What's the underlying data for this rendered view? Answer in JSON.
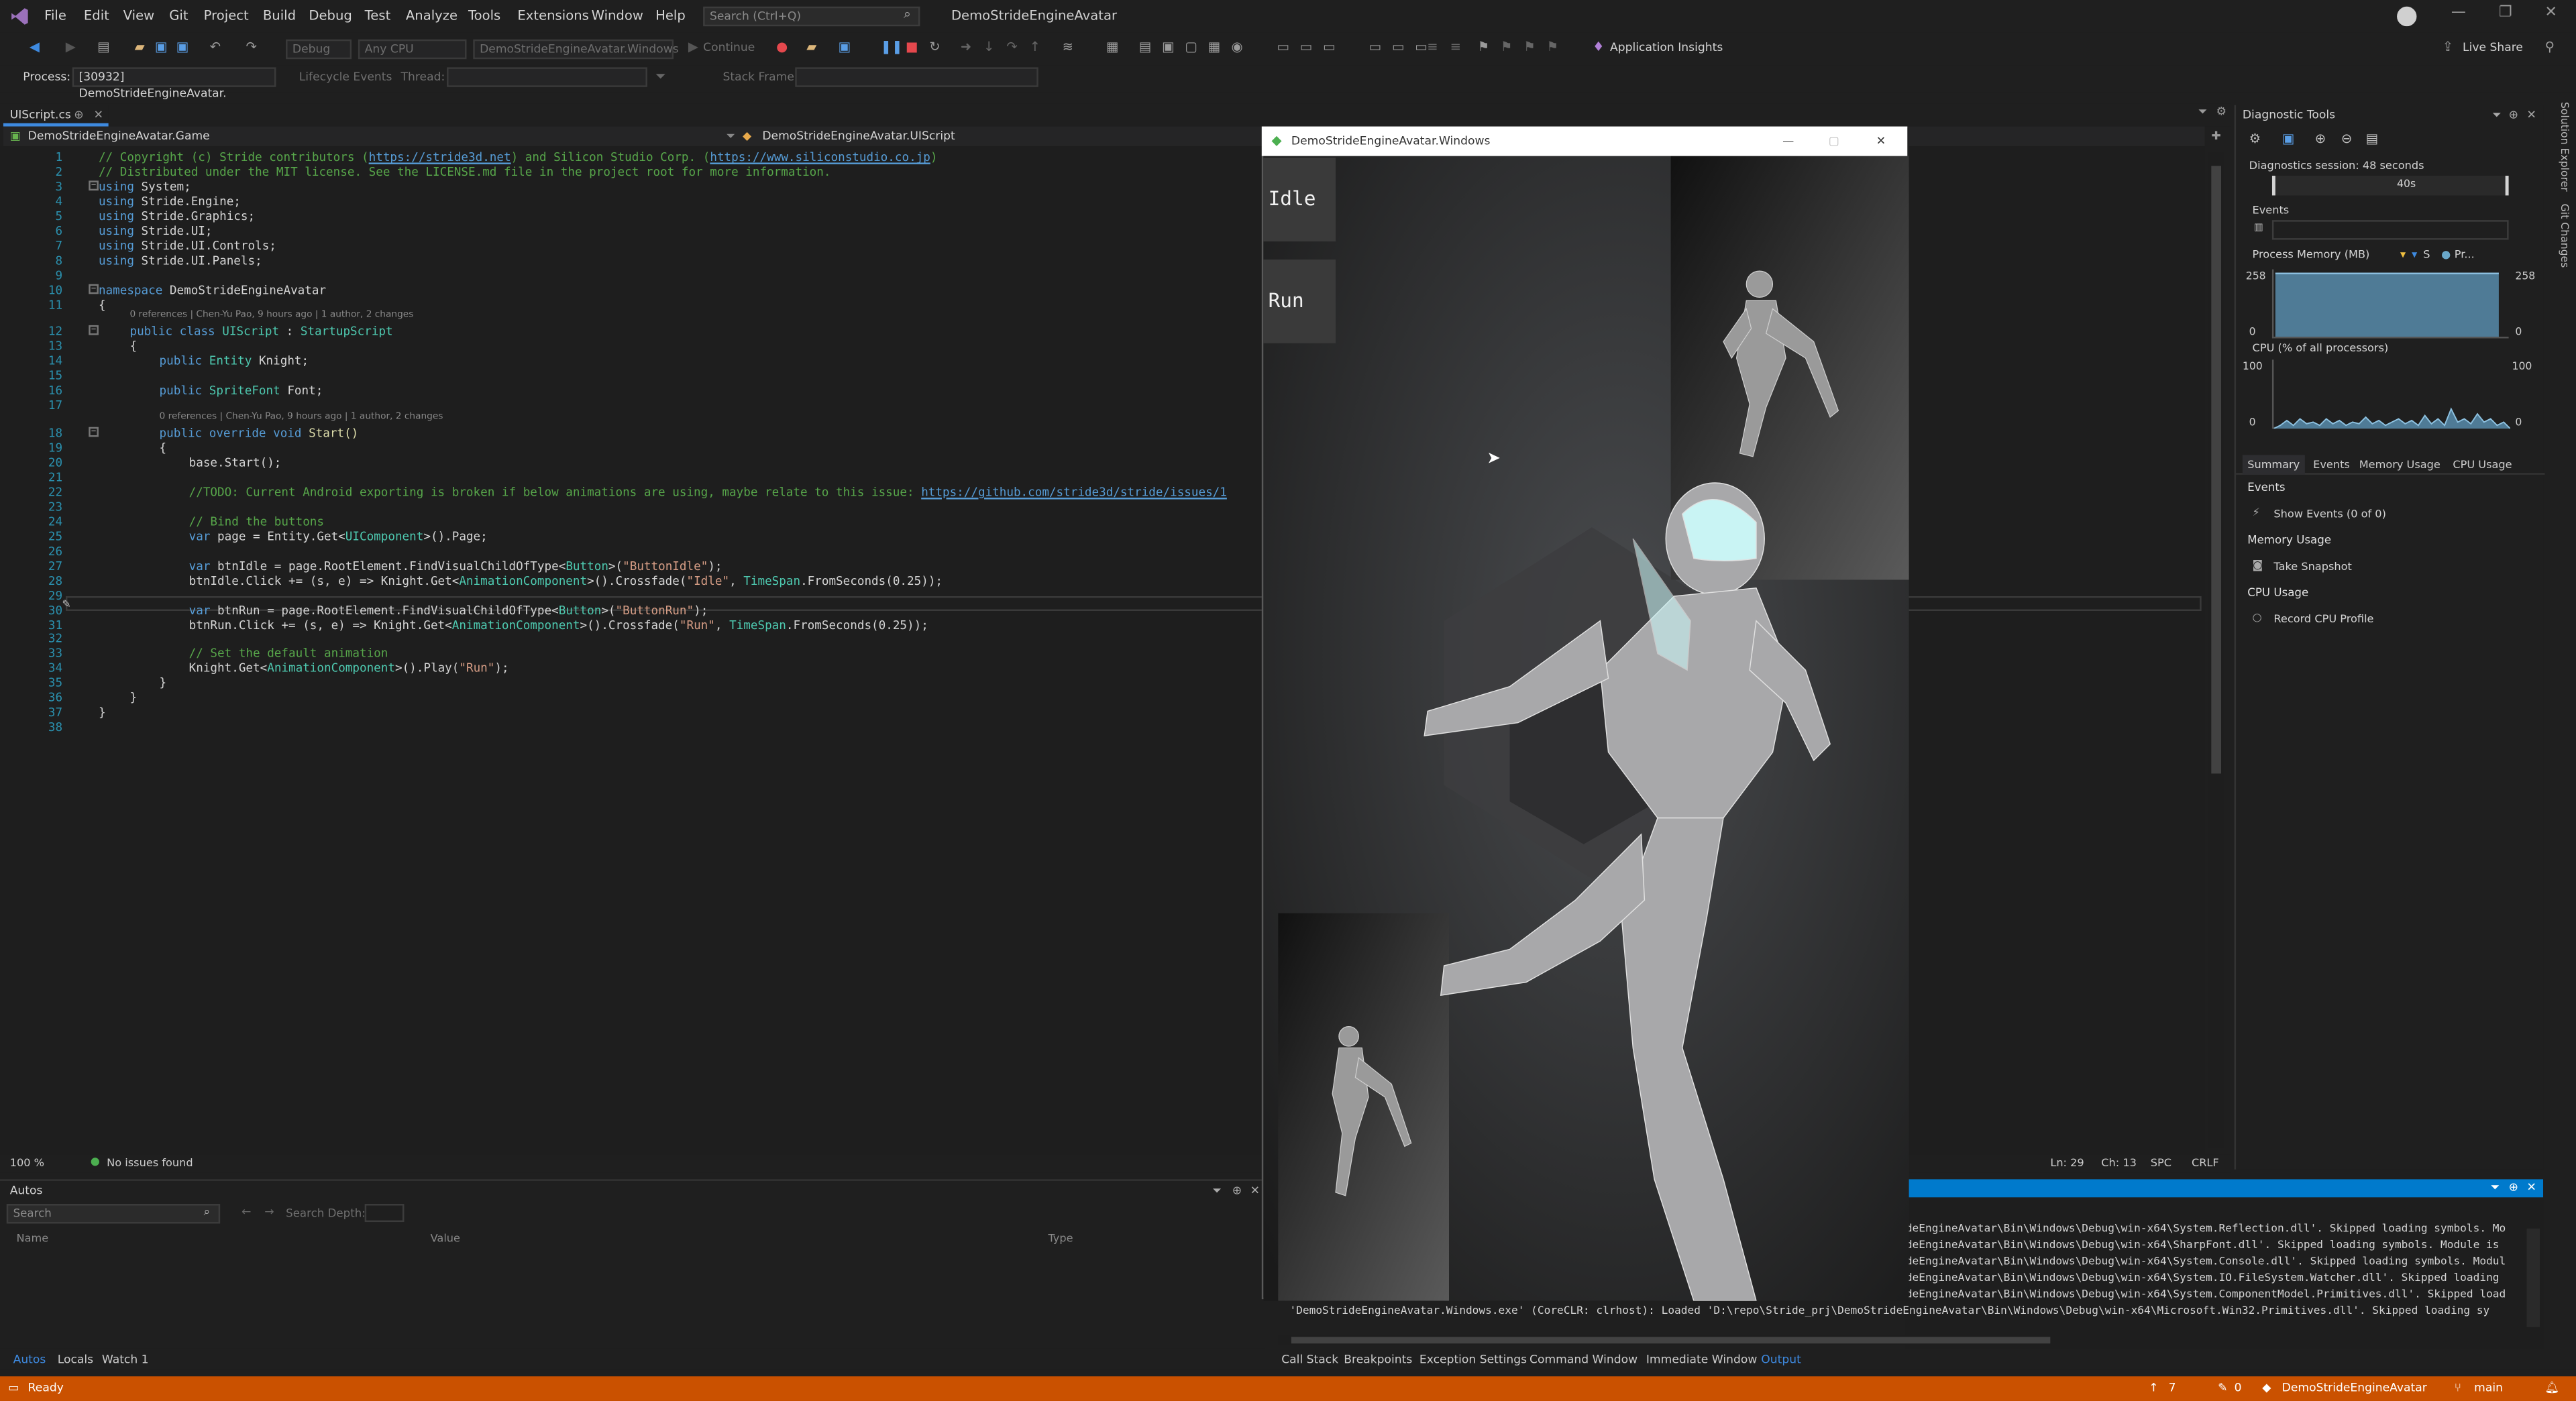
{
  "menu": {
    "items": [
      "File",
      "Edit",
      "View",
      "Git",
      "Project",
      "Build",
      "Debug",
      "Test",
      "Analyze",
      "Tools",
      "Extensions",
      "Window",
      "Help"
    ],
    "search_placeholder": "Search (Ctrl+Q)",
    "solution_title": "DemoStrideEngineAvatar"
  },
  "toolbar": {
    "config": "Debug",
    "platform": "Any CPU",
    "startup": "DemoStrideEngineAvatar.Windows",
    "continue": "Continue",
    "app_insights": "Application Insights",
    "live_share": "Live Share"
  },
  "process_bar": {
    "process_label": "Process:",
    "process_value": "[30932] DemoStrideEngineAvatar.",
    "lifecycle": "Lifecycle Events",
    "thread_label": "Thread:",
    "stack_frame": "Stack Frame:"
  },
  "editor": {
    "tab_name": "UIScript.cs",
    "nav_project": "DemoStrideEngineAvatar.Game",
    "nav_class": "DemoStrideEngineAvatar.UIScript",
    "lens_class": "0 references | Chen-Yu Pao, 9 hours ago | 1 author, 2 changes",
    "lens_method": "0 references | Chen-Yu Pao, 9 hours ago | 1 author, 2 changes",
    "zoom": "100 %",
    "issues": "No issues found",
    "position": "Ln: 29",
    "column": "Ch: 13",
    "spc": "SPC",
    "eol": "CRLF",
    "line_numbers": [
      "1",
      "2",
      "3",
      "4",
      "5",
      "6",
      "7",
      "8",
      "9",
      "10",
      "11",
      "12",
      "13",
      "14",
      "15",
      "16",
      "17",
      "18",
      "19",
      "20",
      "21",
      "22",
      "23",
      "24",
      "25",
      "26",
      "27",
      "28",
      "29",
      "30",
      "31",
      "32",
      "33",
      "34",
      "35",
      "36",
      "37",
      "38"
    ],
    "lines": {
      "l1a": "// Copyright (c) Stride contributors (",
      "l1b": "https://stride3d.net",
      "l1c": ") and Silicon Studio Corp. (",
      "l1d": "https://www.siliconstudio.co.jp",
      "l1e": ")",
      "l2": "// Distributed under the MIT license. See the LICENSE.md file in the project root for more information.",
      "using": "using",
      "ns3": " System;",
      "ns4": " Stride.Engine;",
      "ns5": " Stride.Graphics;",
      "ns6": " Stride.UI;",
      "ns7": " Stride.UI.Controls;",
      "ns8": " Stride.UI.Panels;",
      "l10a": "namespace",
      "l10b": " DemoStrideEngineAvatar",
      "brace_open": "{",
      "brace_close": "}",
      "l12a": "public class",
      "l12b": "UIScript",
      "l12c": " : ",
      "l12d": "StartupScript",
      "l14a": "public",
      "l14b": "Entity",
      "l14c": " Knight;",
      "l16a": "public",
      "l16b": "SpriteFont",
      "l16c": " Font;",
      "l18a": "public override void",
      "l18b": " Start()",
      "l20": "base.Start();",
      "l22a": "//TODO: Current Android exporting is broken if below animations are using, maybe relate to this issue: ",
      "l22b": "https://github.com/stride3d/stride/issues/1",
      "l24": "// Bind the buttons",
      "l25a": "var",
      "l25b": " page = Entity.Get<",
      "l25c": "UIComponent",
      "l25d": ">().Page;",
      "l27a": "var",
      "l27b": " btnIdle = page.RootElement.FindVisualChildOfType<",
      "l27c": "Button",
      "l27d": ">(",
      "l27e": "\"ButtonIdle\"",
      "l27f": ");",
      "l28a": "btnIdle.Click += (s, e) => Knight.Get<",
      "l28b": "AnimationComponent",
      "l28c": ">().Crossfade(",
      "l28d": "\"Idle\"",
      "l28e": ", ",
      "l28f": "TimeSpan",
      "l28g": ".FromSeconds(0.25));",
      "l30b": " btnRun = page.RootElement.FindVisualChildOfType<",
      "l30e": "\"ButtonRun\"",
      "l31a": "btnRun.Click += (s, e) => Knight.Get<",
      "l31d": "\"Run\"",
      "l33": "// Set the default animation",
      "l34a": "Knight.Get<",
      "l34b": "AnimationComponent",
      "l34c": ">().Play(",
      "l34d": "\"Run\"",
      "l34e": ");"
    }
  },
  "game_window": {
    "title": "DemoStrideEngineAvatar.Windows",
    "btn_idle": "Idle",
    "btn_run": "Run"
  },
  "diagnostics": {
    "title": "Diagnostic Tools",
    "session": "Diagnostics session: 48 seconds",
    "timeline_label": "40s",
    "events_header": "Events",
    "memory_header": "Process Memory (MB)",
    "legend_snapshot": "S",
    "legend_private": "Pr...",
    "mem_max_left": "258",
    "mem_min_left": "0",
    "mem_max_right": "258",
    "mem_min_right": "0",
    "memory_fill": 0.95,
    "cpu_header": "CPU (% of all processors)",
    "cpu_max_left": "100",
    "cpu_min_left": "0",
    "cpu_max_right": "100",
    "cpu_min_right": "0",
    "tabs": [
      "Summary",
      "Events",
      "Memory Usage",
      "CPU Usage"
    ],
    "events_section": "Events",
    "show_events": "Show Events (0 of 0)",
    "memory_section": "Memory Usage",
    "take_snapshot": "Take Snapshot",
    "cpu_section": "CPU Usage",
    "record_cpu": "Record CPU Profile",
    "side_tabs": [
      "Solution Explorer",
      "Git Changes"
    ]
  },
  "autos": {
    "title": "Autos",
    "search_placeholder": "Search",
    "search_depth": "Search Depth:",
    "col_name": "Name",
    "col_value": "Value",
    "col_type": "Type",
    "tabs": [
      "Autos",
      "Locals",
      "Watch 1"
    ]
  },
  "output": {
    "lines": [
      "deEngineAvatar\\Bin\\Windows\\Debug\\win-x64\\System.Reflection.dll'. Skipped loading symbols. Mo",
      "deEngineAvatar\\Bin\\Windows\\Debug\\win-x64\\SharpFont.dll'. Skipped loading symbols. Module is",
      "deEngineAvatar\\Bin\\Windows\\Debug\\win-x64\\System.Console.dll'. Skipped loading symbols. Modul",
      "deEngineAvatar\\Bin\\Windows\\Debug\\win-x64\\System.IO.FileSystem.Watcher.dll'. Skipped loading",
      "deEngineAvatar\\Bin\\Windows\\Debug\\win-x64\\System.ComponentModel.Primitives.dll'. Skipped load",
      "'DemoStrideEngineAvatar.Windows.exe' (CoreCLR: clrhost): Loaded 'D:\\repo\\Stride_prj\\DemoStrideEngineAvatar\\Bin\\Windows\\Debug\\win-x64\\Microsoft.Win32.Primitives.dll'. Skipped loading sy"
    ],
    "tabs": [
      "Call Stack",
      "Breakpoints",
      "Exception Settings",
      "Command Window",
      "Immediate Window",
      "Output"
    ]
  },
  "statusbar": {
    "ready": "Ready",
    "up_count": "7",
    "pencil_count": "0",
    "repo": "DemoStrideEngineAvatar",
    "branch": "main"
  },
  "colors": {
    "accent": "#3e8ae0",
    "status": "#ca5100",
    "editor_bg": "#1e1e1e",
    "chrome_bg": "#1f1f1f"
  }
}
